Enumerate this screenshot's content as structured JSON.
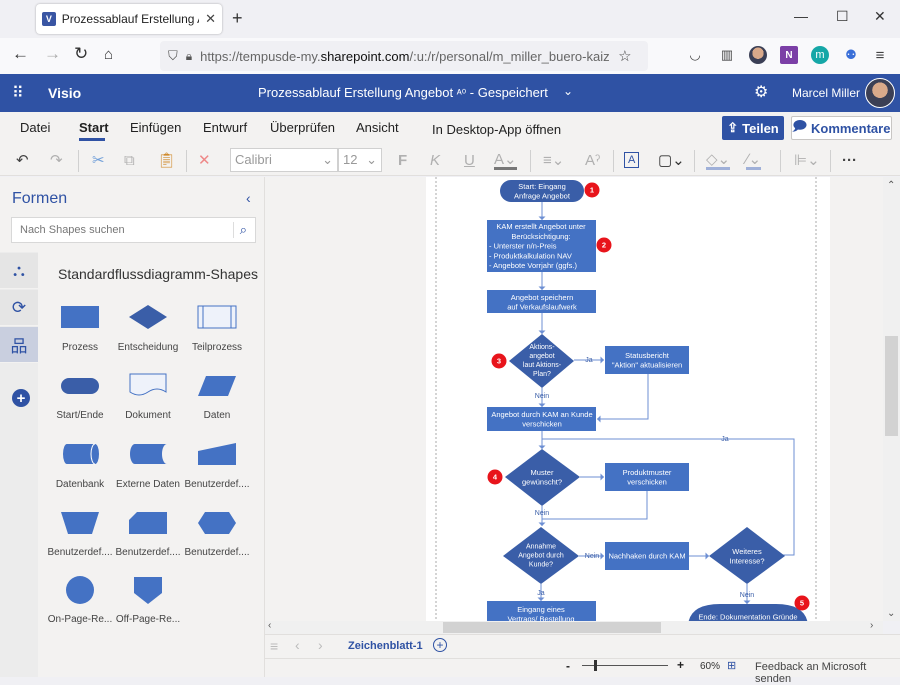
{
  "browser": {
    "tab_title": "Prozessablauf Erstellung Angebot",
    "tab_favicon": "V",
    "url_prefix": "https://tempusde-my.",
    "url_domain": "sharepoint.com",
    "url_suffix": "/:u:/r/personal/m_miller_buero-kaizen_de/",
    "window_controls": {
      "minimize": "—",
      "maximize": "☐",
      "close": "✕"
    }
  },
  "header": {
    "app_name": "Visio",
    "doc_title": "Prozessablauf Erstellung Angebot",
    "save_status": "- Gespeichert",
    "user_name": "Marcel Miller"
  },
  "ribbon": {
    "tabs": [
      {
        "label": "Datei",
        "active": false
      },
      {
        "label": "Start",
        "active": true
      },
      {
        "label": "Einfügen",
        "active": false
      },
      {
        "label": "Entwurf",
        "active": false
      },
      {
        "label": "Überprüfen",
        "active": false
      },
      {
        "label": "Ansicht",
        "active": false
      },
      {
        "label": "In Desktop-App öffnen",
        "active": false
      }
    ],
    "share_label": "Teilen",
    "comments_label": "Kommentare",
    "font_name": "Calibri",
    "font_size": "12",
    "bold_glyph": "F",
    "italic_glyph": "K",
    "underline_glyph": "U"
  },
  "sidebar": {
    "title": "Formen",
    "search_placeholder": "Nach Shapes suchen",
    "stencil_title": "Standardflussdiagramm-Shapes",
    "shapes": [
      {
        "label": "Prozess",
        "icon": "process"
      },
      {
        "label": "Entscheidung",
        "icon": "decision"
      },
      {
        "label": "Teilprozess",
        "icon": "subprocess"
      },
      {
        "label": "Start/Ende",
        "icon": "terminator"
      },
      {
        "label": "Dokument",
        "icon": "document"
      },
      {
        "label": "Daten",
        "icon": "data"
      },
      {
        "label": "Datenbank",
        "icon": "database"
      },
      {
        "label": "Externe Daten",
        "icon": "external-data"
      },
      {
        "label": "Benutzerdef....",
        "icon": "manual-input"
      },
      {
        "label": "Benutzerdef....",
        "icon": "manual-operation"
      },
      {
        "label": "Benutzerdef....",
        "icon": "card"
      },
      {
        "label": "Benutzerdef....",
        "icon": "preparation"
      },
      {
        "label": "On-Page-Re...",
        "icon": "on-page-reference"
      },
      {
        "label": "Off-Page-Re...",
        "icon": "off-page-reference"
      }
    ]
  },
  "diagram": {
    "nodes": {
      "start": [
        "Start: Eingang",
        "Anfrage Angebot"
      ],
      "kam": [
        "KAM erstellt Angebot unter",
        "Berücksichtigung:",
        "- Unterster n/n-Preis",
        "- Produktkalkulation NAV",
        "- Angebote Vorrjahr (ggfs.)"
      ],
      "speichern": [
        "Angebot speichern",
        "auf Verkaufslaufwerk"
      ],
      "aktion": [
        "Aktions-",
        "angebot",
        "laut Aktions-",
        "Plan?"
      ],
      "status": [
        "Statusbericht",
        "\"Aktion\" aktualisieren"
      ],
      "verschicken": [
        "Angebot durch KAM an Kunde",
        "verschicken"
      ],
      "muster": [
        "Muster",
        "gewünscht?"
      ],
      "produktmuster": [
        "Produktmuster",
        "verschicken"
      ],
      "annahme": [
        "Annahme",
        "Angebot durch",
        "Kunde?"
      ],
      "nachhaken": [
        "Nachhaken durch KAM"
      ],
      "interesse": [
        "Weiteres",
        "Interesse?"
      ],
      "vertrag": [
        "Eingang eines",
        "Vertrags/ Bestellung"
      ],
      "ende": [
        "Ende: Dokumentation Gründe"
      ]
    },
    "edge_labels": {
      "ja": "Ja",
      "nein": "Nein"
    },
    "markers": [
      "1",
      "2",
      "3",
      "4",
      "5"
    ]
  },
  "footer": {
    "sheet_name": "Zeichenblatt-1",
    "zoom_level": "60%",
    "zoom_minus": "-",
    "zoom_plus": "+",
    "feedback": "Feedback an Microsoft senden"
  }
}
